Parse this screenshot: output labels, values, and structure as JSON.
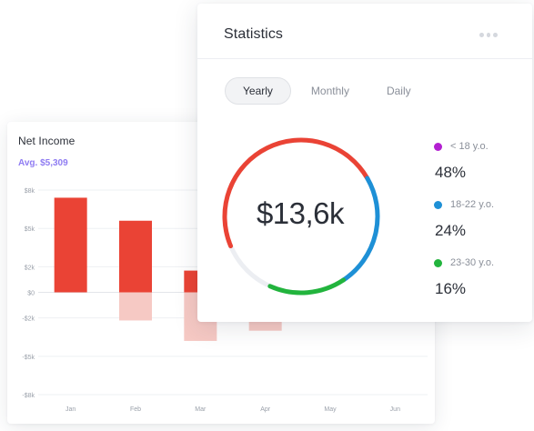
{
  "net_income": {
    "title": "Net Income",
    "average": "Avg. $5,309"
  },
  "statistics": {
    "title": "Statistics",
    "more_icon": "more-horizontal-icon",
    "tabs": [
      {
        "label": "Yearly",
        "active": true
      },
      {
        "label": "Monthly",
        "active": false
      },
      {
        "label": "Daily",
        "active": false
      }
    ],
    "total": "$13,6k",
    "legend": [
      {
        "label": "< 18 y.o.",
        "value": "48%",
        "color": "#b31fd1"
      },
      {
        "label": "18-22 y.o.",
        "value": "24%",
        "color": "#1e90d6"
      },
      {
        "label": "23-30 y.o.",
        "value": "16%",
        "color": "#22b43d"
      }
    ]
  },
  "chart_data": [
    {
      "type": "bar",
      "title": "Net Income",
      "subtitle": "Avg. $5,309",
      "categories": [
        "Jan",
        "Feb",
        "Mar",
        "Apr",
        "May",
        "Jun"
      ],
      "series": [
        {
          "values": [
            7400,
            5600,
            1700,
            null,
            null,
            null
          ],
          "color": "#ea4335"
        },
        {
          "values": [
            null,
            -2200,
            -3800,
            -3000,
            null,
            null
          ],
          "color": "#f6c9c4"
        }
      ],
      "y_ticks": [
        "$8k",
        "$5k",
        "$2k",
        "$0",
        "-$2k",
        "-$5k",
        "-$8k"
      ],
      "y_tick_values": [
        8000,
        5000,
        2000,
        0,
        -2000,
        -5000,
        -8000
      ],
      "grid": true
    },
    {
      "type": "pie",
      "title": "Statistics",
      "center_label": "$13,6k",
      "slices": [
        {
          "label": "< 18 y.o.",
          "value": 48,
          "color": "#ea4335"
        },
        {
          "label": "18-22 y.o.",
          "value": 24,
          "color": "#1e90d6"
        },
        {
          "label": "23-30 y.o.",
          "value": 16,
          "color": "#22b43d"
        }
      ]
    }
  ]
}
